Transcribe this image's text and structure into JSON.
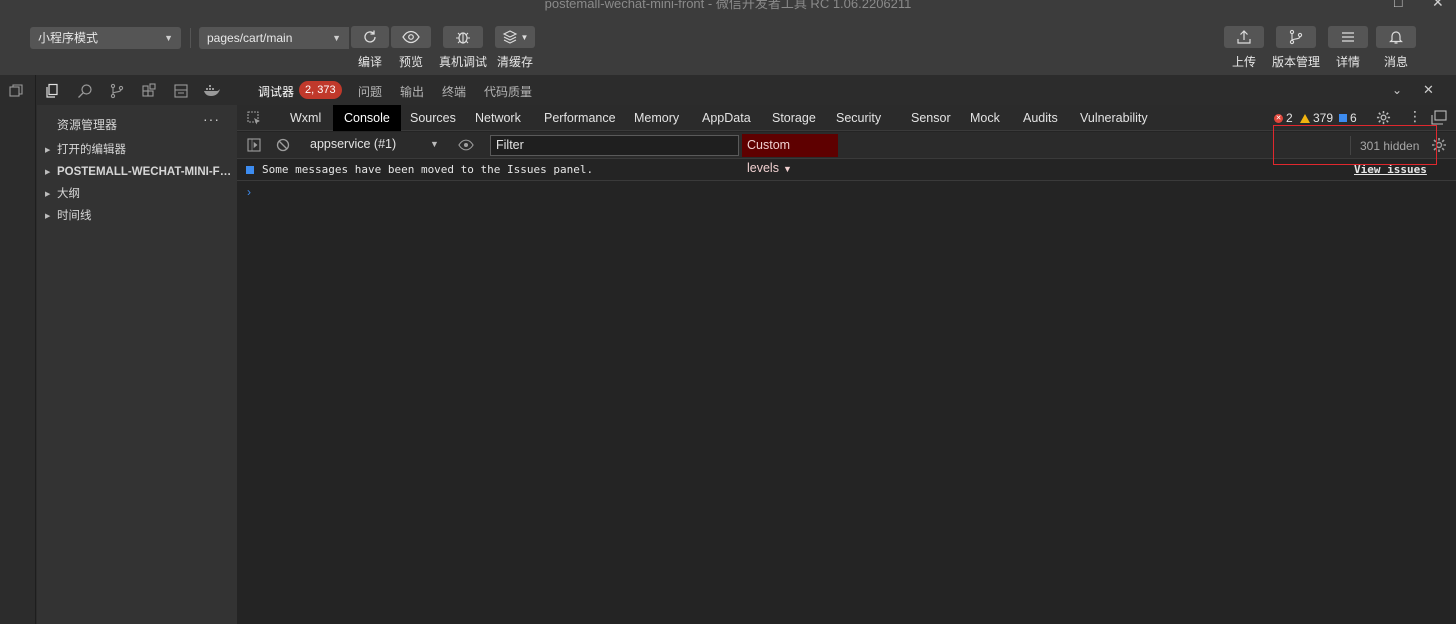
{
  "window": {
    "title": "postemall-wechat-mini-front - 微信开发者工具 RC 1.06.2206211"
  },
  "toolbar": {
    "mode_select": "小程序模式",
    "page_select": "pages/cart/main",
    "compile_label": "编译",
    "preview_label": "预览",
    "realdevice_label": "真机调试",
    "clearcache_label": "清缓存",
    "upload_label": "上传",
    "version_label": "版本管理",
    "details_label": "详情",
    "messages_label": "消息"
  },
  "explorer": {
    "title": "资源管理器",
    "more": "···",
    "items": [
      {
        "label": "打开的编辑器"
      },
      {
        "label": "POSTEMALL-WECHAT-MINI-FRO..."
      },
      {
        "label": "大纲"
      },
      {
        "label": "时间线"
      }
    ]
  },
  "debugger": {
    "tabs": [
      {
        "label": "调试器"
      },
      {
        "label": "问题"
      },
      {
        "label": "输出"
      },
      {
        "label": "终端"
      },
      {
        "label": "代码质量"
      }
    ],
    "badge": "2, 373"
  },
  "devtools": {
    "tabs": [
      {
        "label": "Wxml"
      },
      {
        "label": "Console"
      },
      {
        "label": "Sources"
      },
      {
        "label": "Network"
      },
      {
        "label": "Performance"
      },
      {
        "label": "Memory"
      },
      {
        "label": "AppData"
      },
      {
        "label": "Storage"
      },
      {
        "label": "Security"
      },
      {
        "label": "Sensor"
      },
      {
        "label": "Mock"
      },
      {
        "label": "Audits"
      },
      {
        "label": "Vulnerability"
      }
    ],
    "errors": "2",
    "warnings": "379",
    "infos": "6"
  },
  "console": {
    "context": "appservice (#1)",
    "filter_placeholder": "Filter",
    "levels": "Custom levels",
    "hidden": "301 hidden",
    "message": "Some messages have been moved to the Issues panel.",
    "view_issues": "View issues",
    "prompt": "›"
  },
  "colors": {
    "accent_error": "#e0463a",
    "accent_warning": "#f2b40f",
    "accent_info": "#3d8cf0",
    "levels_bg": "#5e0000",
    "badge_bg": "#c0392b",
    "highlight": "#e0282e"
  }
}
